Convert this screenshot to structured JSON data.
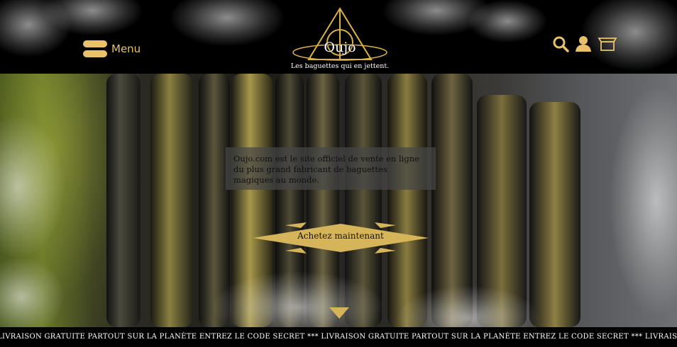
{
  "header": {
    "menu_label": "Menu",
    "logo_name": "Oujo",
    "logo_tagline": "Les baguettes qui en jettent.",
    "icons": [
      "search-icon",
      "user-icon",
      "cart-icon"
    ],
    "accent_color": "#e8c16a"
  },
  "hero": {
    "intro_text": "Oujo.com est le site officiel de vente en ligne du plus grand fabricant de baguettes magiques au monde.",
    "cta_label": "Achetez maintenant",
    "scroll_icon": "chevron-down-icon"
  },
  "ticker": {
    "text": "LIVRAISON GRATUITE PARTOUT SUR LA PLANÈTE ENTREZ LE CODE SECRET  *** LIVRAISON GRATUITE PARTOUT SUR LA PLANÈTE ENTREZ LE CODE SECRET *** LIVRAISON GRATUITE PART"
  }
}
